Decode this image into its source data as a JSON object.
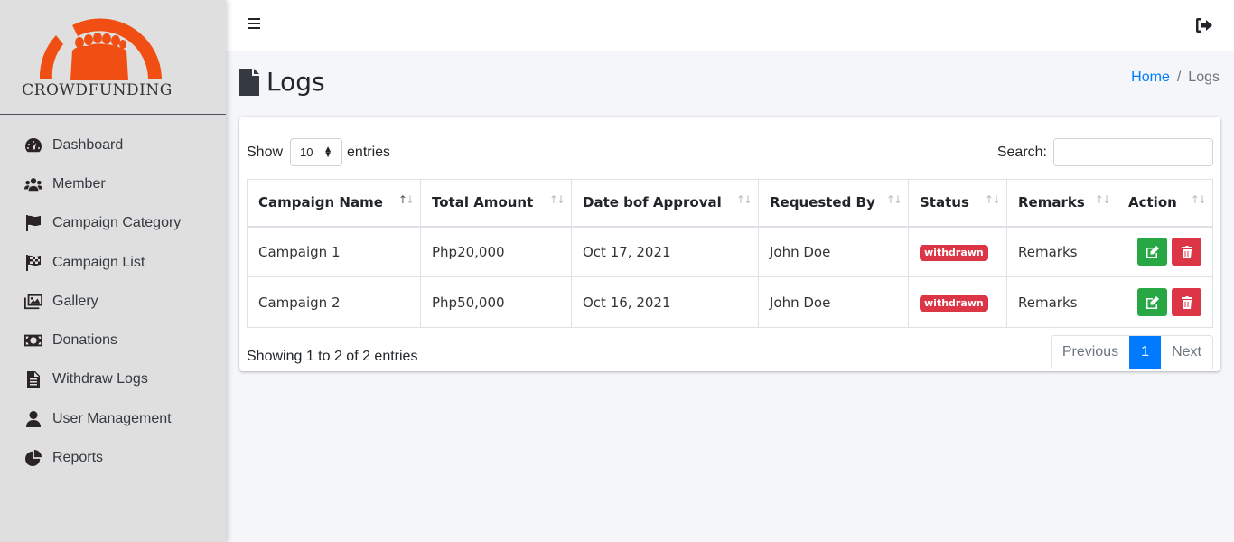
{
  "brand": {
    "name": "CROWDFUNDING",
    "logo_color": "#f04e12"
  },
  "sidebar": {
    "items": [
      {
        "label": "Dashboard",
        "icon": "tachometer-icon"
      },
      {
        "label": "Member",
        "icon": "users-icon"
      },
      {
        "label": "Campaign Category",
        "icon": "flag-icon"
      },
      {
        "label": "Campaign List",
        "icon": "flag-checkered-icon"
      },
      {
        "label": "Gallery",
        "icon": "images-icon"
      },
      {
        "label": "Donations",
        "icon": "money-bill-icon"
      },
      {
        "label": "Withdraw Logs",
        "icon": "file-alt-icon"
      },
      {
        "label": "User Management",
        "icon": "user-icon"
      },
      {
        "label": "Reports",
        "icon": "chart-pie-icon"
      }
    ]
  },
  "topbar": {
    "menu_icon": "bars-icon",
    "logout_icon": "sign-out-icon"
  },
  "header": {
    "title": "Logs",
    "title_icon": "file-icon",
    "breadcrumb": {
      "home": "Home",
      "separator": "/",
      "current": "Logs"
    }
  },
  "table_controls": {
    "show_label": "Show",
    "page_length": "10",
    "entries_label": "entries",
    "search_label": "Search:",
    "search_value": ""
  },
  "table": {
    "columns": [
      "Campaign Name",
      "Total Amount",
      "Date bof Approval",
      "Requested By",
      "Status",
      "Remarks",
      "Action"
    ],
    "rows": [
      {
        "campaign": "Campaign 1",
        "amount": "Php20,000",
        "date": "Oct 17, 2021",
        "requested_by": "John Doe",
        "status": "withdrawn",
        "remarks": "Remarks"
      },
      {
        "campaign": "Campaign 2",
        "amount": "Php50,000",
        "date": "Oct 16, 2021",
        "requested_by": "John Doe",
        "status": "withdrawn",
        "remarks": "Remarks"
      }
    ]
  },
  "footer": {
    "info": "Showing 1 to 2 of 2 entries",
    "pagination": {
      "previous": "Previous",
      "current": "1",
      "next": "Next"
    }
  },
  "colors": {
    "primary": "#007bff",
    "success": "#28a745",
    "danger": "#dc3545",
    "sidebar_bg": "#dfdfdf"
  }
}
